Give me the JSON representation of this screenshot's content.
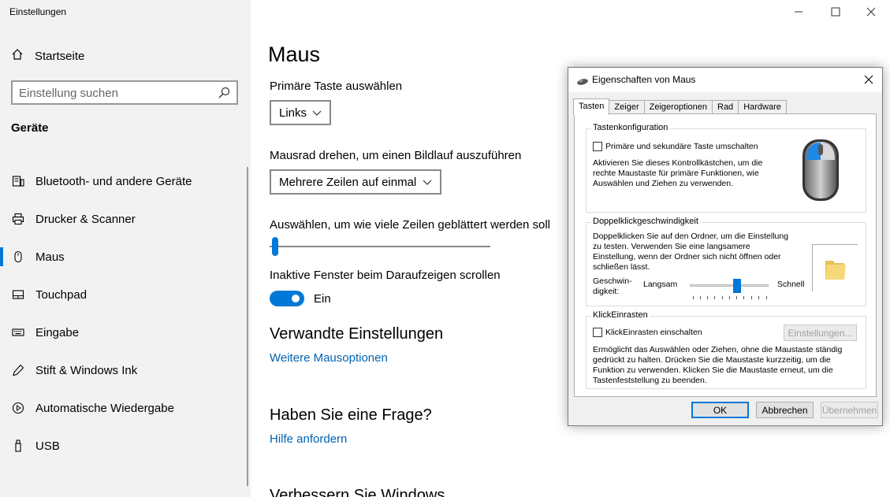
{
  "app": {
    "title": "Einstellungen"
  },
  "sidebar": {
    "home_label": "Startseite",
    "search_placeholder": "Einstellung suchen",
    "section_title": "Geräte",
    "items": [
      {
        "label": "Bluetooth- und andere Geräte",
        "icon": "bluetooth-devices-icon"
      },
      {
        "label": "Drucker & Scanner",
        "icon": "printer-icon"
      },
      {
        "label": "Maus",
        "icon": "mouse-icon",
        "active": true
      },
      {
        "label": "Touchpad",
        "icon": "touchpad-icon"
      },
      {
        "label": "Eingabe",
        "icon": "keyboard-icon"
      },
      {
        "label": "Stift & Windows Ink",
        "icon": "pen-icon"
      },
      {
        "label": "Automatische Wiedergabe",
        "icon": "autoplay-icon"
      },
      {
        "label": "USB",
        "icon": "usb-icon"
      }
    ]
  },
  "main": {
    "title": "Maus",
    "primary_button": {
      "label": "Primäre Taste auswählen",
      "value": "Links"
    },
    "wheel": {
      "label": "Mausrad drehen, um einen Bildlauf auszuführen",
      "value": "Mehrere Zeilen auf einmal"
    },
    "lines": {
      "label": "Auswählen, um wie viele Zeilen geblättert werden soll",
      "value_fraction": 0.02
    },
    "inactive_scroll": {
      "label": "Inaktive Fenster beim Daraufzeigen scrollen",
      "state": "Ein",
      "on": true
    },
    "related": {
      "heading": "Verwandte Einstellungen",
      "link": "Weitere Mausoptionen"
    },
    "question": {
      "heading": "Haben Sie eine Frage?",
      "link": "Hilfe anfordern"
    },
    "improve": {
      "heading": "Verbessern Sie Windows"
    }
  },
  "dialog": {
    "title": "Eigenschaften von Maus",
    "tabs": [
      "Tasten",
      "Zeiger",
      "Zeigeroptionen",
      "Rad",
      "Hardware"
    ],
    "button_config": {
      "title": "Tastenkonfiguration",
      "checkbox": "Primäre und sekundäre Taste umschalten",
      "desc": [
        "Aktivieren Sie dieses Kontrollkästchen, um die",
        "rechte Maustaste für primäre Funktionen, wie",
        "Auswählen und Ziehen zu verwenden."
      ]
    },
    "double_click": {
      "title": "Doppelklickgeschwindigkeit",
      "desc": [
        "Doppelklicken Sie auf den Ordner, um die Einstellung",
        "zu testen. Verwenden Sie eine langsamere",
        "Einstellung, wenn der Ordner sich nicht öffnen oder",
        "schließen lässt."
      ],
      "speed_label": [
        "Geschwin-",
        "digkeit:"
      ],
      "slow": "Langsam",
      "fast": "Schnell",
      "value_fraction": 0.6
    },
    "click_lock": {
      "title": "KlickEinrasten",
      "checkbox": "KlickEinrasten einschalten",
      "settings_button": "Einstellungen...",
      "desc": [
        "Ermöglicht das Auswählen oder Ziehen, ohne die Maustaste ständig",
        "gedrückt zu halten. Drücken Sie die Maustaste kurzzeitig, um die",
        "Funktion zu verwenden. Klicken Sie die Maustaste erneut, um die",
        "Tastenfeststellung zu beenden."
      ]
    },
    "buttons": {
      "ok": "OK",
      "cancel": "Abbrechen",
      "apply": "Übernehmen"
    }
  },
  "colors": {
    "accent": "#0078d7",
    "link": "#0063b1",
    "sidebar_bg": "#f2f2f2"
  }
}
